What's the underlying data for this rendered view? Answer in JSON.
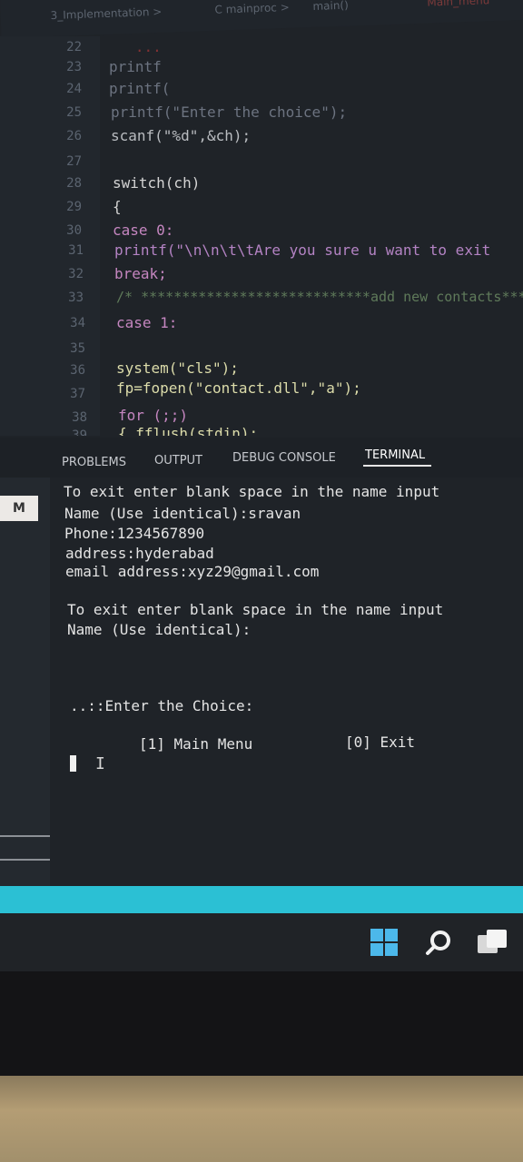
{
  "breadcrumb": {
    "items": [
      "3_Implementation >",
      "C mainproc >",
      "main()",
      "Main_menu"
    ]
  },
  "editor": {
    "lines": [
      {
        "num": "22",
        "code": "   ..."
      },
      {
        "num": "23",
        "code": "printf"
      },
      {
        "num": "24",
        "code": "printf("
      },
      {
        "num": "25",
        "code": "printf(\"Enter the choice\");"
      },
      {
        "num": "26",
        "code": "scanf(\"%d\",&ch);"
      },
      {
        "num": "27",
        "code": ""
      },
      {
        "num": "28",
        "code": "switch(ch)"
      },
      {
        "num": "29",
        "code": "{"
      },
      {
        "num": "30",
        "code": "case 0:"
      },
      {
        "num": "31",
        "code": "printf(\"\\n\\n\\t\\tAre you sure u want to exit"
      },
      {
        "num": "32",
        "code": "break;"
      },
      {
        "num": "33",
        "code": "/* ****************************add new contacts****"
      },
      {
        "num": "34",
        "code": "case 1:"
      },
      {
        "num": "35",
        "code": ""
      },
      {
        "num": "36",
        "code": "system(\"cls\");"
      },
      {
        "num": "37",
        "code": "fp=fopen(\"contact.dll\",\"a\");"
      },
      {
        "num": "38",
        "code": "for (;;)"
      },
      {
        "num": "39",
        "code": "{ fflush(stdin);"
      }
    ]
  },
  "panel": {
    "tabs": [
      "PROBLEMS",
      "OUTPUT",
      "DEBUG CONSOLE",
      "TERMINAL"
    ],
    "active_tab": "TERMINAL"
  },
  "terminal": {
    "lines": [
      "To exit enter blank space in the name input",
      "Name (Use identical):sravan",
      "Phone:1234567890",
      "address:hyderabad",
      "email address:xyz29@gmail.com",
      "",
      "To exit enter blank space in the name input",
      "Name (Use identical):",
      "",
      "",
      "..::Enter the Choice:",
      "",
      "[1] Main Menu",
      "[0] Exit"
    ]
  },
  "activity": {
    "marker": "M"
  },
  "colors": {
    "status_bar": "#2bc0d4",
    "editor_bg": "#1f2328",
    "windows_logo": "#4cb8ea"
  },
  "taskbar": {
    "icons": [
      "windows-start-icon",
      "search-icon",
      "task-view-icon"
    ]
  }
}
